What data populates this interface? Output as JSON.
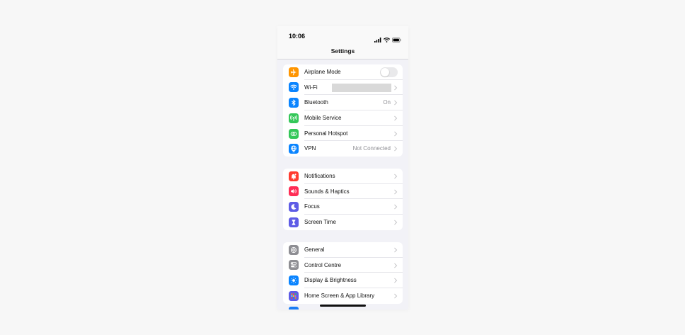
{
  "status": {
    "time": "10:06",
    "icons": [
      "cellular-signal-icon",
      "wifi-icon",
      "battery-icon"
    ]
  },
  "nav": {
    "title": "Settings"
  },
  "groups": [
    {
      "items": [
        {
          "label": "Airplane Mode",
          "icon": "airplane-icon",
          "color": "#ff9500",
          "control": "toggle",
          "toggle_on": false
        },
        {
          "label": "Wi-Fi",
          "icon": "wifi-icon",
          "color": "#0a84ff",
          "value": "",
          "redacted": true
        },
        {
          "label": "Bluetooth",
          "icon": "bluetooth-icon",
          "color": "#0a84ff",
          "value": "On"
        },
        {
          "label": "Mobile Service",
          "icon": "antenna-icon",
          "color": "#34c759"
        },
        {
          "label": "Personal Hotspot",
          "icon": "hotspot-icon",
          "color": "#34c759"
        },
        {
          "label": "VPN",
          "icon": "globe-icon",
          "color": "#0a84ff",
          "value": "Not Connected"
        }
      ]
    },
    {
      "items": [
        {
          "label": "Notifications",
          "icon": "bell-icon",
          "color": "#ff3b30"
        },
        {
          "label": "Sounds & Haptics",
          "icon": "speaker-icon",
          "color": "#ff2d55"
        },
        {
          "label": "Focus",
          "icon": "moon-icon",
          "color": "#5e5ce6"
        },
        {
          "label": "Screen Time",
          "icon": "hourglass-icon",
          "color": "#5e5ce6"
        }
      ]
    },
    {
      "items": [
        {
          "label": "General",
          "icon": "gear-icon",
          "color": "#8e8e93"
        },
        {
          "label": "Control Centre",
          "icon": "switches-icon",
          "color": "#8e8e93"
        },
        {
          "label": "Display & Brightness",
          "icon": "sun-icon",
          "color": "#0a84ff"
        },
        {
          "label": "Home Screen & App Library",
          "icon": "app-grid-icon",
          "color": "#5e5ce6"
        }
      ]
    }
  ]
}
